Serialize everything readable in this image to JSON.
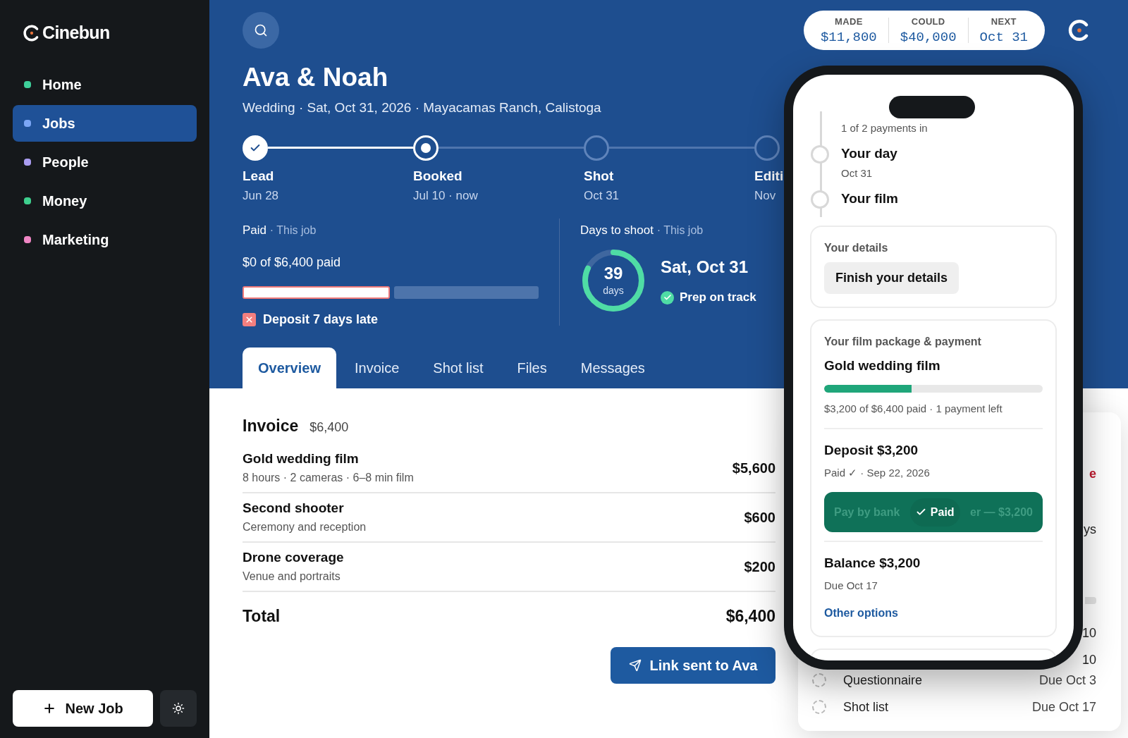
{
  "sidebar": {
    "logo": "Cinebun",
    "items": [
      {
        "label": "Home",
        "color": "#3ecf9a",
        "selected": false
      },
      {
        "label": "Jobs",
        "color": "#7ba6f5",
        "selected": true
      },
      {
        "label": "People",
        "color": "#a99cf0",
        "selected": false
      },
      {
        "label": "Money",
        "color": "#3ecf8e",
        "selected": false
      },
      {
        "label": "Marketing",
        "color": "#ef86c4",
        "selected": false
      }
    ],
    "new_job": "New Job"
  },
  "stats": [
    {
      "label": "MADE",
      "value": "$11,800"
    },
    {
      "label": "COULD",
      "value": "$40,000"
    },
    {
      "label": "NEXT",
      "value": "Oct 31"
    }
  ],
  "job": {
    "title": "Ava & Noah",
    "subtitle": "Wedding · Sat, Oct 31, 2026 · Mayacamas Ranch, Calistoga",
    "stages": [
      {
        "label": "Lead",
        "date": "Jun 28",
        "kind": "done"
      },
      {
        "label": "Booked",
        "date": "Jul 10 · now",
        "kind": "current"
      },
      {
        "label": "Shot",
        "date": "Oct 31",
        "kind": "upcoming"
      },
      {
        "label": "Editi",
        "date": "Nov",
        "kind": "upcoming"
      }
    ],
    "paid": {
      "title": "Paid",
      "scope": "· This job",
      "summary": "$0 of $6,400 paid",
      "segments": [
        {
          "kind": "overdue"
        },
        {
          "kind": "upcoming"
        }
      ],
      "alert": "Deposit 7 days late"
    },
    "countdown": {
      "title": "Days to shoot",
      "scope": "· This job",
      "number": "39",
      "unit": "days",
      "level": 0.82,
      "date": "Sat, Oct 31",
      "status": "Prep on track"
    }
  },
  "tabs": [
    {
      "label": "Overview",
      "selected": true
    },
    {
      "label": "Invoice",
      "selected": false
    },
    {
      "label": "Shot list",
      "selected": false
    },
    {
      "label": "Files",
      "selected": false
    },
    {
      "label": "Messages",
      "selected": false
    }
  ],
  "invoice": {
    "title": "Invoice",
    "amount": "$6,400",
    "lines": [
      {
        "name": "Gold wedding film",
        "detail": "8 hours · 2 cameras · 6–8 min film",
        "price": "$5,600"
      },
      {
        "name": "Second shooter",
        "detail": "Ceremony and reception",
        "price": "$600"
      },
      {
        "name": "Drone coverage",
        "detail": "Venue and portraits",
        "price": "$200"
      }
    ],
    "total_label": "Total",
    "total": "$6,400",
    "send_button": "Link sent to Ava"
  },
  "side_panel": {
    "fragments": [
      {
        "text": "e",
        "kind": "alert"
      },
      {
        "text": "ys",
        "kind": "plain"
      },
      {
        "text": "10",
        "kind": "plain"
      },
      {
        "text": "10",
        "kind": "plain"
      }
    ],
    "tasks": [
      {
        "name": "Questionnaire",
        "due": "Due Oct 3"
      },
      {
        "name": "Shot list",
        "due": "Due Oct 17"
      }
    ]
  },
  "phone": {
    "timeline": [
      {
        "subtitle": "1 of 2 payments in"
      },
      {
        "title": "Your day",
        "subtitle": "Oct 31"
      },
      {
        "title": "Your film"
      }
    ],
    "details": {
      "title": "Your details",
      "button": "Finish your details"
    },
    "package": {
      "title": "Your film package & payment",
      "name": "Gold wedding film",
      "level": 0.4,
      "summary": "$3,200 of $6,400 paid · 1 payment left",
      "deposit": {
        "title": "Deposit $3,200",
        "status": "Paid ✓ · Sep 22, 2026",
        "faded_left": "Pay by bank",
        "faded_right": "er — $3,200",
        "button": "Paid"
      },
      "balance": {
        "title": "Balance $3,200",
        "due": "Due Oct 17"
      },
      "link": "Other options"
    }
  }
}
